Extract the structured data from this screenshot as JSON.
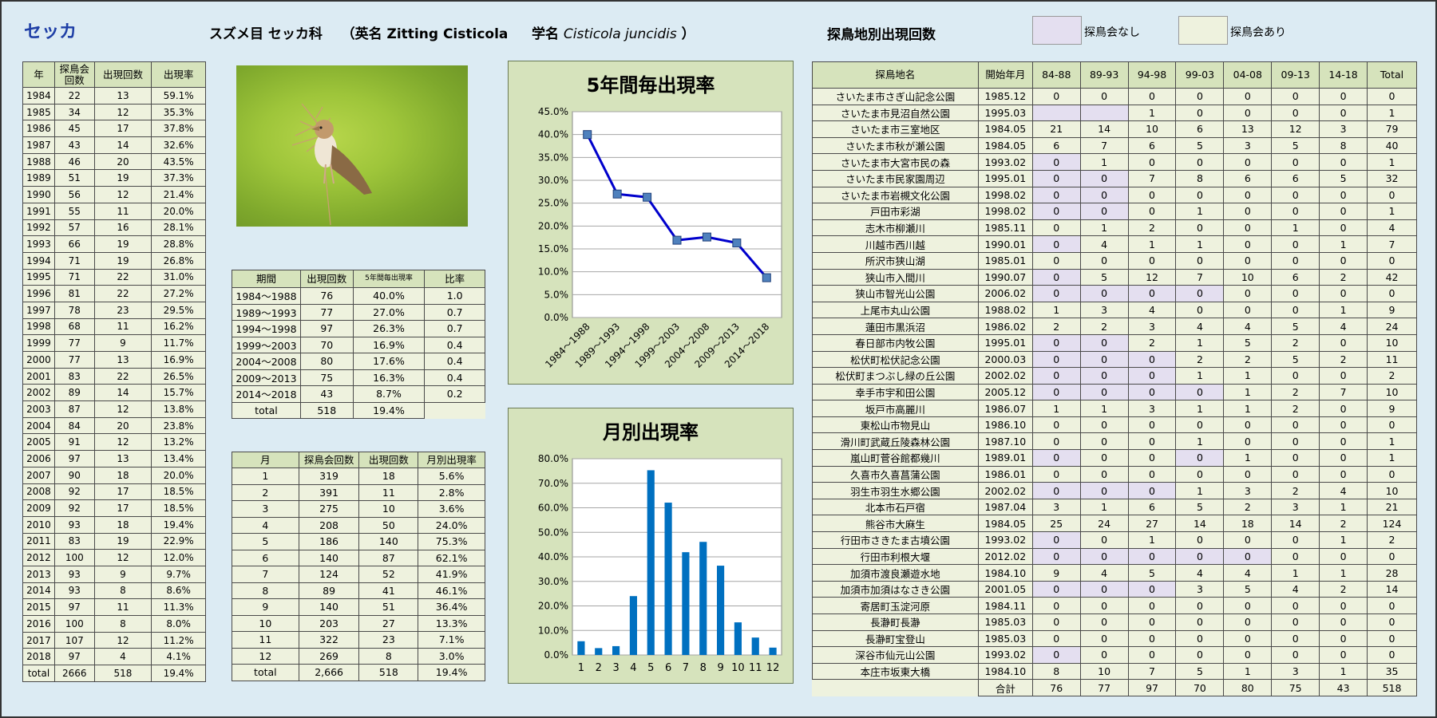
{
  "species": "セッカ",
  "header": {
    "order_family": "スズメ目 セッカ科",
    "english_prefix": "（英名",
    "english_name": "Zitting Cisticola",
    "sci_prefix": "学名",
    "sci_name": "Cisticola juncidis",
    "closing": "）"
  },
  "site_section_title": "探鳥地別出現回数",
  "legend": {
    "no_meeting": "探鳥会なし",
    "with_meeting": "探鳥会あり",
    "no_meeting_color": "#e4dff0",
    "with_meeting_color": "#eef2de"
  },
  "yearly_table": {
    "headers": [
      "年",
      "探鳥会\n回数",
      "出現回数",
      "出現率"
    ],
    "rows": [
      [
        "1984",
        "22",
        "13",
        "59.1%"
      ],
      [
        "1985",
        "34",
        "12",
        "35.3%"
      ],
      [
        "1986",
        "45",
        "17",
        "37.8%"
      ],
      [
        "1987",
        "43",
        "14",
        "32.6%"
      ],
      [
        "1988",
        "46",
        "20",
        "43.5%"
      ],
      [
        "1989",
        "51",
        "19",
        "37.3%"
      ],
      [
        "1990",
        "56",
        "12",
        "21.4%"
      ],
      [
        "1991",
        "55",
        "11",
        "20.0%"
      ],
      [
        "1992",
        "57",
        "16",
        "28.1%"
      ],
      [
        "1993",
        "66",
        "19",
        "28.8%"
      ],
      [
        "1994",
        "71",
        "19",
        "26.8%"
      ],
      [
        "1995",
        "71",
        "22",
        "31.0%"
      ],
      [
        "1996",
        "81",
        "22",
        "27.2%"
      ],
      [
        "1997",
        "78",
        "23",
        "29.5%"
      ],
      [
        "1998",
        "68",
        "11",
        "16.2%"
      ],
      [
        "1999",
        "77",
        "9",
        "11.7%"
      ],
      [
        "2000",
        "77",
        "13",
        "16.9%"
      ],
      [
        "2001",
        "83",
        "22",
        "26.5%"
      ],
      [
        "2002",
        "89",
        "14",
        "15.7%"
      ],
      [
        "2003",
        "87",
        "12",
        "13.8%"
      ],
      [
        "2004",
        "84",
        "20",
        "23.8%"
      ],
      [
        "2005",
        "91",
        "12",
        "13.2%"
      ],
      [
        "2006",
        "97",
        "13",
        "13.4%"
      ],
      [
        "2007",
        "90",
        "18",
        "20.0%"
      ],
      [
        "2008",
        "92",
        "17",
        "18.5%"
      ],
      [
        "2009",
        "92",
        "17",
        "18.5%"
      ],
      [
        "2010",
        "93",
        "18",
        "19.4%"
      ],
      [
        "2011",
        "83",
        "19",
        "22.9%"
      ],
      [
        "2012",
        "100",
        "12",
        "12.0%"
      ],
      [
        "2013",
        "93",
        "9",
        "9.7%"
      ],
      [
        "2014",
        "93",
        "8",
        "8.6%"
      ],
      [
        "2015",
        "97",
        "11",
        "11.3%"
      ],
      [
        "2016",
        "100",
        "8",
        "8.0%"
      ],
      [
        "2017",
        "107",
        "12",
        "11.2%"
      ],
      [
        "2018",
        "97",
        "4",
        "4.1%"
      ]
    ],
    "total": [
      "total",
      "2666",
      "518",
      "19.4%"
    ]
  },
  "period_table": {
    "headers": [
      "期間",
      "出現回数",
      "5年間毎出現率",
      "比率"
    ],
    "rows": [
      [
        "1984〜1988",
        "76",
        "40.0%",
        "1.0"
      ],
      [
        "1989〜1993",
        "77",
        "27.0%",
        "0.7"
      ],
      [
        "1994〜1998",
        "97",
        "26.3%",
        "0.7"
      ],
      [
        "1999〜2003",
        "70",
        "16.9%",
        "0.4"
      ],
      [
        "2004〜2008",
        "80",
        "17.6%",
        "0.4"
      ],
      [
        "2009〜2013",
        "75",
        "16.3%",
        "0.4"
      ],
      [
        "2014〜2018",
        "43",
        "8.7%",
        "0.2"
      ]
    ],
    "total": [
      "total",
      "518",
      "19.4%"
    ]
  },
  "month_table": {
    "headers": [
      "月",
      "探鳥会回数",
      "出現回数",
      "月別出現率"
    ],
    "rows": [
      [
        "1",
        "319",
        "18",
        "5.6%"
      ],
      [
        "2",
        "391",
        "11",
        "2.8%"
      ],
      [
        "3",
        "275",
        "10",
        "3.6%"
      ],
      [
        "4",
        "208",
        "50",
        "24.0%"
      ],
      [
        "5",
        "186",
        "140",
        "75.3%"
      ],
      [
        "6",
        "140",
        "87",
        "62.1%"
      ],
      [
        "7",
        "124",
        "52",
        "41.9%"
      ],
      [
        "8",
        "89",
        "41",
        "46.1%"
      ],
      [
        "9",
        "140",
        "51",
        "36.4%"
      ],
      [
        "10",
        "203",
        "27",
        "13.3%"
      ],
      [
        "11",
        "322",
        "23",
        "7.1%"
      ],
      [
        "12",
        "269",
        "8",
        "3.0%"
      ]
    ],
    "total": [
      "total",
      "2,666",
      "518",
      "19.4%"
    ]
  },
  "site_table": {
    "headers": [
      "探鳥地名",
      "開始年月",
      "84-88",
      "89-93",
      "94-98",
      "99-03",
      "04-08",
      "09-13",
      "14-18",
      "Total"
    ],
    "rows": [
      {
        "cells": [
          "さいたま市さぎ山記念公園",
          "1985.12",
          "0",
          "0",
          "0",
          "0",
          "0",
          "0",
          "0",
          "0"
        ],
        "hl": []
      },
      {
        "cells": [
          "さいたま市見沼自然公園",
          "1995.03",
          "",
          "",
          "1",
          "0",
          "0",
          "0",
          "0",
          "1"
        ],
        "hl": [
          2,
          3
        ]
      },
      {
        "cells": [
          "さいたま市三室地区",
          "1984.05",
          "21",
          "14",
          "10",
          "6",
          "13",
          "12",
          "3",
          "79"
        ],
        "hl": []
      },
      {
        "cells": [
          "さいたま市秋が瀬公園",
          "1984.05",
          "6",
          "7",
          "6",
          "5",
          "3",
          "5",
          "8",
          "40"
        ],
        "hl": []
      },
      {
        "cells": [
          "さいたま市大宮市民の森",
          "1993.02",
          "0",
          "1",
          "0",
          "0",
          "0",
          "0",
          "0",
          "1"
        ],
        "hl": [
          2
        ]
      },
      {
        "cells": [
          "さいたま市民家園周辺",
          "1995.01",
          "0",
          "0",
          "7",
          "8",
          "6",
          "6",
          "5",
          "32"
        ],
        "hl": [
          2,
          3
        ]
      },
      {
        "cells": [
          "さいたま市岩槻文化公園",
          "1998.02",
          "0",
          "0",
          "0",
          "0",
          "0",
          "0",
          "0",
          "0"
        ],
        "hl": [
          2,
          3
        ]
      },
      {
        "cells": [
          "戸田市彩湖",
          "1998.02",
          "0",
          "0",
          "0",
          "1",
          "0",
          "0",
          "0",
          "1"
        ],
        "hl": [
          2,
          3
        ]
      },
      {
        "cells": [
          "志木市柳瀬川",
          "1985.11",
          "0",
          "1",
          "2",
          "0",
          "0",
          "1",
          "0",
          "4"
        ],
        "hl": []
      },
      {
        "cells": [
          "川越市西川越",
          "1990.01",
          "0",
          "4",
          "1",
          "1",
          "0",
          "0",
          "1",
          "7"
        ],
        "hl": [
          2
        ]
      },
      {
        "cells": [
          "所沢市狭山湖",
          "1985.01",
          "0",
          "0",
          "0",
          "0",
          "0",
          "0",
          "0",
          "0"
        ],
        "hl": []
      },
      {
        "cells": [
          "狭山市入間川",
          "1990.07",
          "0",
          "5",
          "12",
          "7",
          "10",
          "6",
          "2",
          "42"
        ],
        "hl": [
          2
        ]
      },
      {
        "cells": [
          "狭山市智光山公園",
          "2006.02",
          "0",
          "0",
          "0",
          "0",
          "0",
          "0",
          "0",
          "0"
        ],
        "hl": [
          2,
          3,
          4,
          5
        ]
      },
      {
        "cells": [
          "上尾市丸山公園",
          "1988.02",
          "1",
          "3",
          "4",
          "0",
          "0",
          "0",
          "1",
          "9"
        ],
        "hl": []
      },
      {
        "cells": [
          "蓮田市黒浜沼",
          "1986.02",
          "2",
          "2",
          "3",
          "4",
          "4",
          "5",
          "4",
          "24"
        ],
        "hl": []
      },
      {
        "cells": [
          "春日部市内牧公園",
          "1995.01",
          "0",
          "0",
          "2",
          "1",
          "5",
          "2",
          "0",
          "10"
        ],
        "hl": [
          2,
          3
        ]
      },
      {
        "cells": [
          "松伏町松伏記念公園",
          "2000.03",
          "0",
          "0",
          "0",
          "2",
          "2",
          "5",
          "2",
          "11"
        ],
        "hl": [
          2,
          3,
          4
        ]
      },
      {
        "cells": [
          "松伏町まつぶし緑の丘公園",
          "2002.02",
          "0",
          "0",
          "0",
          "1",
          "1",
          "0",
          "0",
          "2"
        ],
        "hl": [
          2,
          3,
          4
        ]
      },
      {
        "cells": [
          "幸手市宇和田公園",
          "2005.12",
          "0",
          "0",
          "0",
          "0",
          "1",
          "2",
          "7",
          "10"
        ],
        "hl": [
          2,
          3,
          4,
          5
        ]
      },
      {
        "cells": [
          "坂戸市高麗川",
          "1986.07",
          "1",
          "1",
          "3",
          "1",
          "1",
          "2",
          "0",
          "9"
        ],
        "hl": []
      },
      {
        "cells": [
          "東松山市物見山",
          "1986.10",
          "0",
          "0",
          "0",
          "0",
          "0",
          "0",
          "0",
          "0"
        ],
        "hl": []
      },
      {
        "cells": [
          "滑川町武蔵丘陵森林公園",
          "1987.10",
          "0",
          "0",
          "0",
          "1",
          "0",
          "0",
          "0",
          "1"
        ],
        "hl": []
      },
      {
        "cells": [
          "嵐山町菅谷館都幾川",
          "1989.01",
          "0",
          "0",
          "0",
          "0",
          "1",
          "0",
          "0",
          "1"
        ],
        "hl": [
          2,
          5
        ]
      },
      {
        "cells": [
          "久喜市久喜菖蒲公園",
          "1986.01",
          "0",
          "0",
          "0",
          "0",
          "0",
          "0",
          "0",
          "0"
        ],
        "hl": []
      },
      {
        "cells": [
          "羽生市羽生水郷公園",
          "2002.02",
          "0",
          "0",
          "0",
          "1",
          "3",
          "2",
          "4",
          "10"
        ],
        "hl": [
          2,
          3,
          4
        ]
      },
      {
        "cells": [
          "北本市石戸宿",
          "1987.04",
          "3",
          "1",
          "6",
          "5",
          "2",
          "3",
          "1",
          "21"
        ],
        "hl": []
      },
      {
        "cells": [
          "熊谷市大麻生",
          "1984.05",
          "25",
          "24",
          "27",
          "14",
          "18",
          "14",
          "2",
          "124"
        ],
        "hl": []
      },
      {
        "cells": [
          "行田市さきたま古墳公園",
          "1993.02",
          "0",
          "0",
          "1",
          "0",
          "0",
          "0",
          "1",
          "2"
        ],
        "hl": [
          2
        ]
      },
      {
        "cells": [
          "行田市利根大堰",
          "2012.02",
          "0",
          "0",
          "0",
          "0",
          "0",
          "0",
          "0",
          "0"
        ],
        "hl": [
          2,
          3,
          4,
          5,
          6
        ]
      },
      {
        "cells": [
          "加須市渡良瀬遊水地",
          "1984.10",
          "9",
          "4",
          "5",
          "4",
          "4",
          "1",
          "1",
          "28"
        ],
        "hl": []
      },
      {
        "cells": [
          "加須市加須はなさき公園",
          "2001.05",
          "0",
          "0",
          "0",
          "3",
          "5",
          "4",
          "2",
          "14"
        ],
        "hl": [
          2,
          3,
          4
        ]
      },
      {
        "cells": [
          "寄居町玉淀河原",
          "1984.11",
          "0",
          "0",
          "0",
          "0",
          "0",
          "0",
          "0",
          "0"
        ],
        "hl": []
      },
      {
        "cells": [
          "長瀞町長瀞",
          "1985.03",
          "0",
          "0",
          "0",
          "0",
          "0",
          "0",
          "0",
          "0"
        ],
        "hl": []
      },
      {
        "cells": [
          "長瀞町宝登山",
          "1985.03",
          "0",
          "0",
          "0",
          "0",
          "0",
          "0",
          "0",
          "0"
        ],
        "hl": []
      },
      {
        "cells": [
          "深谷市仙元山公園",
          "1993.02",
          "0",
          "0",
          "0",
          "0",
          "0",
          "0",
          "0",
          "0"
        ],
        "hl": [
          2
        ]
      },
      {
        "cells": [
          "本庄市坂東大橋",
          "1984.10",
          "8",
          "10",
          "7",
          "5",
          "1",
          "3",
          "1",
          "35"
        ],
        "hl": []
      }
    ],
    "total": [
      "合計",
      "76",
      "77",
      "97",
      "70",
      "80",
      "75",
      "43",
      "518"
    ]
  },
  "chart_data": [
    {
      "type": "line",
      "title": "5年間毎出現率",
      "categories": [
        "1984〜1988",
        "1989〜1993",
        "1994〜1998",
        "1999〜2003",
        "2004〜2008",
        "2009〜2013",
        "2014〜2018"
      ],
      "values": [
        40.0,
        27.0,
        26.3,
        16.9,
        17.6,
        16.3,
        8.7
      ],
      "ylim": [
        0,
        45
      ],
      "yticks": [
        "0.0%",
        "5.0%",
        "10.0%",
        "15.0%",
        "20.0%",
        "25.0%",
        "30.0%",
        "35.0%",
        "40.0%",
        "45.0%"
      ],
      "grid": true,
      "color": "#0000cc",
      "marker_color": "#4f81bd"
    },
    {
      "type": "bar",
      "title": "月別出現率",
      "categories": [
        "1",
        "2",
        "3",
        "4",
        "5",
        "6",
        "7",
        "8",
        "9",
        "10",
        "11",
        "12"
      ],
      "values": [
        5.6,
        2.8,
        3.6,
        24.0,
        75.3,
        62.1,
        41.9,
        46.1,
        36.4,
        13.3,
        7.1,
        3.0
      ],
      "ylim": [
        0,
        80
      ],
      "yticks": [
        "0.0%",
        "10.0%",
        "20.0%",
        "30.0%",
        "40.0%",
        "50.0%",
        "60.0%",
        "70.0%",
        "80.0%"
      ],
      "grid": true,
      "color": "#0070c0"
    }
  ]
}
